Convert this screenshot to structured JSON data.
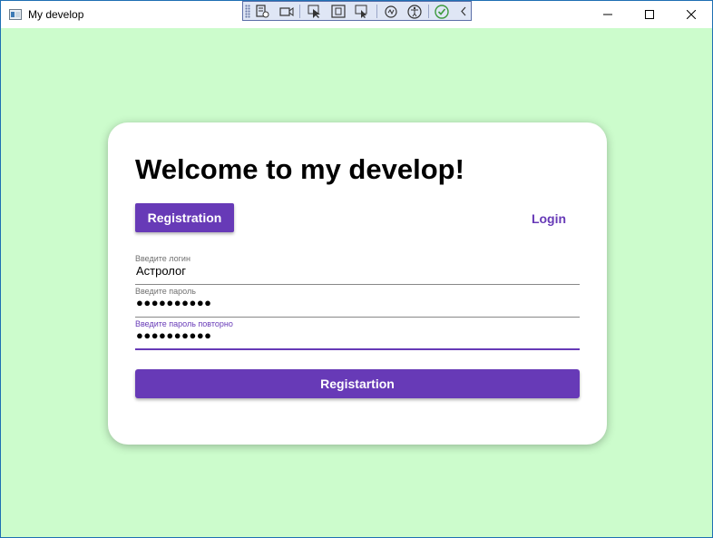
{
  "window": {
    "title": "My develop",
    "background": "#ccfccc",
    "accent": "#673ab7"
  },
  "debug_toolbar": {
    "icons": [
      "grip-icon",
      "live-visual-tree-icon",
      "video-icon",
      "select-element-icon",
      "display-layout-adorners-icon",
      "track-focus-icon",
      "binding-failures-icon",
      "accessibility-icon",
      "hot-reload-ok-icon",
      "collapse-icon"
    ]
  },
  "card": {
    "heading": "Welcome to my develop!",
    "tabs": {
      "registration_label": "Registration",
      "login_label": "Login"
    },
    "fields": [
      {
        "label": "Введите логин",
        "value": "Астролог",
        "type": "text"
      },
      {
        "label": "Введите пароль",
        "value": "●●●●●●●●●●",
        "type": "password"
      },
      {
        "label": "Введите пароль повторно",
        "value": "●●●●●●●●●●",
        "type": "password",
        "focused": true
      }
    ],
    "submit_label": "Registartion"
  }
}
